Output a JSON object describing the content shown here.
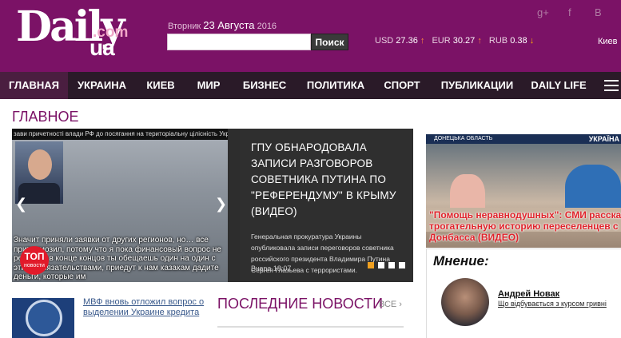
{
  "header": {
    "logo": {
      "daily": "Daily",
      "com": ".com",
      "ua": "ua"
    },
    "date": {
      "weekday": "Вторник",
      "day": "23 Августа",
      "year": "2016"
    },
    "search": {
      "placeholder": "",
      "button": "Поиск"
    },
    "rates": [
      {
        "code": "USD",
        "value": "27.36",
        "trend": "up"
      },
      {
        "code": "EUR",
        "value": "30.27",
        "trend": "up"
      },
      {
        "code": "RUB",
        "value": "0.38",
        "trend": "down"
      }
    ],
    "city": "Киев",
    "social_icons": [
      "google-plus-icon",
      "facebook-icon",
      "vk-icon"
    ]
  },
  "nav": {
    "items": [
      "ГЛАВНАЯ",
      "УКРАИНА",
      "КИЕВ",
      "МИР",
      "БИЗНЕС",
      "ПОЛИТИКА",
      "СПОРТ",
      "ПУБЛИКАЦИИ",
      "DAILY LIFE"
    ],
    "active_index": 0
  },
  "main": {
    "section_title": "ГЛАВНОЕ",
    "slider": {
      "image_caption_top": "зави причетності влади РФ до посягання на територіальну цілісність Укр",
      "image_subtitle": "Значит приняли заявки от других регионов, но… все притормозил, потому что я пока финансовый вопрос не решил, а в конце концов ты обещаешь один на один с этими обязательствами, приедут к нам казакам дадите деньги, которые им",
      "badge": {
        "main": "ТОП",
        "sub": "новости"
      },
      "title": "ГПУ ОБНАРОДОВАЛА ЗАПИСИ РАЗГОВОРОВ СОВЕТНИКА ПУТИНА ПО \"РЕФЕРЕНДУМУ\" В КРЫМУ (ВИДЕО)",
      "description": "Генеральная прокуратура Украины опубликовала записи переговоров советника российского президента Владимира Путина Сергея Глазьева с террористами.",
      "time": "Вчера 18:07",
      "dots": 4,
      "active_dot": 0
    },
    "photo": {
      "strip": "ДОНЕЦЬКА ОБЛАСТЬ",
      "brand": "УКРАЇНА",
      "caption": "\"Помощь неравнодушных\": СМИ рассказал\nтрогательную историю переселенцев с\nДонбасса (ВИДЕО)"
    },
    "opinion": {
      "title": "Мнение:",
      "author": "Андрей Новак",
      "text": "Що відбувається з курсом гривні"
    },
    "news": {
      "link": "МВФ вновь отложил вопрос о выделении Украине кредита"
    },
    "latest": {
      "title": "ПОСЛЕДНИЕ НОВОСТИ",
      "all": "ВСЕ ›"
    }
  }
}
